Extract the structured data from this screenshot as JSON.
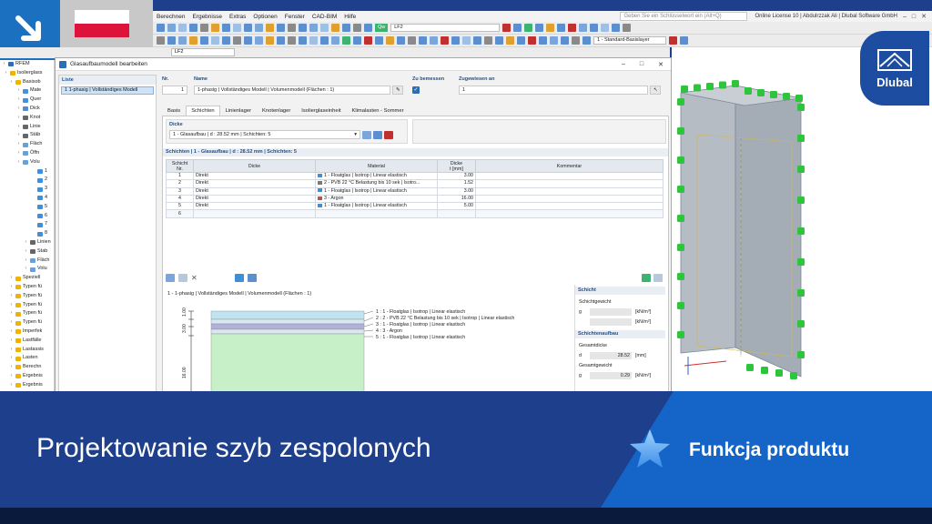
{
  "app": {
    "menu": [
      "Berechnen",
      "Ergebnisse",
      "Extras",
      "Optionen",
      "Fenster",
      "CAD-BIM",
      "Hilfe"
    ],
    "search_placeholder": "Geben Sie ein Schlüsselwort ein (Alt+Q)",
    "license": "Online License 10 | Abdulrzzak Ali | Dlubal Software GmbH",
    "loadcase": "LF2",
    "loadcase_tag": "Qw",
    "loadcase_2": "LF2",
    "layer_dropdown": "1 - Standard-Basislayer"
  },
  "navigator": {
    "items": [
      {
        "label": "RFEM",
        "color": "#2f6db5"
      },
      {
        "label": "Isolierglass",
        "color": "#f0b400"
      },
      {
        "label": "Basisob",
        "color": "#f0b400"
      },
      {
        "label": "Mate",
        "color": "#4a90d9"
      },
      {
        "label": "Quer",
        "color": "#4a90d9"
      },
      {
        "label": "Dick",
        "color": "#4a90d9"
      },
      {
        "label": "Knot",
        "color": "#666666"
      },
      {
        "label": "Linie",
        "color": "#666666"
      },
      {
        "label": "Stäb",
        "color": "#666666"
      },
      {
        "label": "Fläch",
        "color": "#6aa0d8"
      },
      {
        "label": "Öffn",
        "color": "#6aa0d8"
      },
      {
        "label": "Volu",
        "color": "#6aa0d8"
      },
      {
        "label": "1",
        "color": "#3d8fe0"
      },
      {
        "label": "2",
        "color": "#3d8fe0"
      },
      {
        "label": "3",
        "color": "#3d8fe0"
      },
      {
        "label": "4",
        "color": "#3d8fe0"
      },
      {
        "label": "5",
        "color": "#3d8fe0"
      },
      {
        "label": "6",
        "color": "#3d8fe0"
      },
      {
        "label": "7",
        "color": "#3d8fe0"
      },
      {
        "label": "8",
        "color": "#3d8fe0"
      },
      {
        "label": "Linien",
        "color": "#666666"
      },
      {
        "label": "Stab",
        "color": "#666666"
      },
      {
        "label": "Fläch",
        "color": "#6aa0d8"
      },
      {
        "label": "Volu",
        "color": "#6aa0d8"
      },
      {
        "label": "Speziell",
        "color": "#f0b400"
      },
      {
        "label": "Typen fü",
        "color": "#f0b400"
      },
      {
        "label": "Typen fü",
        "color": "#f0b400"
      },
      {
        "label": "Typen fü",
        "color": "#f0b400"
      },
      {
        "label": "Typen fü",
        "color": "#f0b400"
      },
      {
        "label": "Typen fü",
        "color": "#f0b400"
      },
      {
        "label": "Imperfek",
        "color": "#f0b400"
      },
      {
        "label": "Lastfälle",
        "color": "#f0b400"
      },
      {
        "label": "Lastassis",
        "color": "#f0b400"
      },
      {
        "label": "Lasten",
        "color": "#f0b400"
      },
      {
        "label": "Berechn",
        "color": "#f0b400"
      },
      {
        "label": "Ergebnis",
        "color": "#f0b400"
      },
      {
        "label": "Ergebnis",
        "color": "#f0b400"
      }
    ]
  },
  "dialog": {
    "title": "Glasaufbaumodell bearbeiten",
    "list_label": "Liste",
    "list_items": [
      "1  1-phasig | Vollständiges Modell"
    ],
    "nr_label": "Nr.",
    "nr_value": "1",
    "name_label": "Name",
    "name_value": "1-phasig | Vollständiges Modell | Volumenmodell (Flächen : 1)",
    "zu_bemessen_label": "Zu bemessen",
    "zugewiesen_label": "Zugewiesen an",
    "zugewiesen_value": "1",
    "tabs": [
      "Basis",
      "Schichten",
      "Linienlager",
      "Knotenlager",
      "Isolierglaseinheit",
      "Klimalasten - Sommer"
    ],
    "dicke_label": "Dicke",
    "dicke_value": "1 - Glasaufbau | d : 28.52 mm | Schichten: 5",
    "schichten_header": "Schichten | 1 - Glasaufbau | d : 28.52 mm | Schichten: 5",
    "columns": {
      "nr_1": "Schicht",
      "nr_2": "Nr.",
      "dicke": "Dicke",
      "material": "Material",
      "t_1": "Dicke",
      "t_2": "t [mm]",
      "kommentar": "Kommentar"
    },
    "rows": [
      {
        "nr": "1",
        "dicke": "Direkt",
        "material": "1 - Floatglas | Isotrop | Linear elastisch",
        "t": "3.00",
        "color": "#3f8fd8"
      },
      {
        "nr": "2",
        "dicke": "Direkt",
        "material": "2 - PVB 22 °C Belastung bis 10 sek | Isotro...",
        "t": "1.52",
        "color": "#7a7a7a"
      },
      {
        "nr": "3",
        "dicke": "Direkt",
        "material": "1 - Floatglas | Isotrop | Linear elastisch",
        "t": "3.00",
        "color": "#3f8fd8"
      },
      {
        "nr": "4",
        "dicke": "Direkt",
        "material": "3 - Argon",
        "t": "16.00",
        "color": "#c0504d"
      },
      {
        "nr": "5",
        "dicke": "Direkt",
        "material": "1 - Floatglas | Isotrop | Linear elastisch",
        "t": "5.00",
        "color": "#3f8fd8"
      },
      {
        "nr": "6",
        "dicke": "",
        "material": "",
        "t": "",
        "color": ""
      }
    ],
    "preview_title": "1 - 1-phasig | Vollständiges Modell | Volumenmodell (Flächen : 1)",
    "preview_scale": [
      "1.00",
      "3.00",
      "16.00"
    ],
    "legend": [
      "1 :  1 - Floatglas | Isotrop | Linear elastisch",
      "2 :  2 - PVB 22 °C Belastung bis 10 sek | Isotrop | Linear elastisch",
      "3 :  1 - Floatglas | Isotrop | Linear elastisch",
      "4 :  3 - Argon",
      "5 :  1 - Floatglas | Isotrop | Linear elastisch"
    ],
    "props": {
      "schicht_label": "Schicht",
      "schichtgewicht_label": "Schichtgewicht",
      "g_label": "g",
      "g_unit": "[kN/m³]",
      "g2_unit": "[kN/m²]",
      "schichtenaufbau_label": "Schichtenaufbau",
      "gesamtdicke_label": "Gesamtdicke",
      "d_label": "d",
      "d_value": "28.52",
      "d_unit": "[mm]",
      "gesamtgewicht_label": "Gesamtgewicht",
      "gg_label": "g",
      "gg_value": "0.29",
      "gg_unit": "[kN/m²]"
    }
  },
  "brand": {
    "name": "Dlubal",
    "accent": "#1c4da1"
  },
  "banner": {
    "headline": "Projektowanie szyb zespolonych",
    "feature": "Funkcja produktu"
  }
}
